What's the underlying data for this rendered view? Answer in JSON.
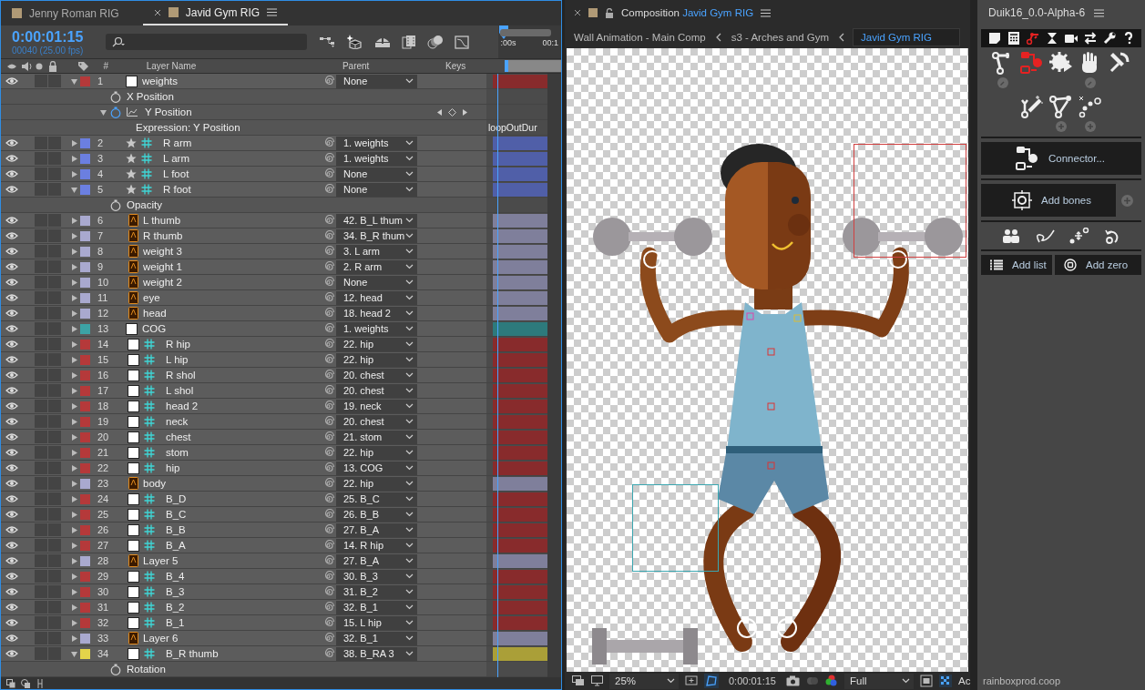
{
  "timeline": {
    "tabs": [
      {
        "label": "Jenny Roman RIG",
        "selected": false
      },
      {
        "label": "Javid Gym RIG",
        "selected": true
      }
    ],
    "time": "0:00:01:15",
    "frame_info": "00040 (25.00 fps)",
    "columns": {
      "number": "#",
      "name": "Layer Name",
      "parent": "Parent",
      "keys": "Keys"
    },
    "ruler": [
      ":00s",
      "00:1"
    ],
    "layers": [
      {
        "number": "1",
        "name": "weights",
        "color": "#b5393a",
        "kind": "solid",
        "expanded": true,
        "parent": "None",
        "children": [
          {
            "name": "X Position",
            "kind": "property"
          },
          {
            "name": "Y Position",
            "kind": "graph",
            "expanded": true,
            "children": [
              {
                "name": "Expression: Y Position",
                "kind": "expression",
                "expression": "loopOutDur"
              }
            ]
          }
        ]
      },
      {
        "number": "2",
        "name": "R arm",
        "color": "#6b7fe0",
        "kind": "star-grid",
        "expanded": false,
        "parent": "1. weights"
      },
      {
        "number": "3",
        "name": "L arm",
        "color": "#6b7fe0",
        "kind": "star-grid",
        "expanded": false,
        "parent": "1. weights"
      },
      {
        "number": "4",
        "name": "L foot",
        "color": "#6b7fe0",
        "kind": "star-grid",
        "expanded": false,
        "parent": "None"
      },
      {
        "number": "5",
        "name": "R foot",
        "color": "#6b7fe0",
        "kind": "star-grid",
        "expanded": true,
        "parent": "None",
        "children": [
          {
            "name": "Opacity",
            "kind": "property"
          }
        ]
      },
      {
        "number": "6",
        "name": "L thumb",
        "color": "#a9a9cf",
        "kind": "ai",
        "expanded": false,
        "parent": "42. B_L thum"
      },
      {
        "number": "7",
        "name": "R thumb",
        "color": "#a9a9cf",
        "kind": "ai",
        "expanded": false,
        "parent": "34. B_R thum"
      },
      {
        "number": "8",
        "name": "weight 3",
        "color": "#a9a9cf",
        "kind": "ai",
        "expanded": false,
        "parent": "3. L arm"
      },
      {
        "number": "9",
        "name": "weight 1",
        "color": "#a9a9cf",
        "kind": "ai",
        "expanded": false,
        "parent": "2. R arm"
      },
      {
        "number": "10",
        "name": "weight 2",
        "color": "#a9a9cf",
        "kind": "ai",
        "expanded": false,
        "parent": "None"
      },
      {
        "number": "11",
        "name": "eye",
        "color": "#a9a9cf",
        "kind": "ai",
        "expanded": false,
        "parent": "12. head"
      },
      {
        "number": "12",
        "name": "head",
        "color": "#a9a9cf",
        "kind": "ai",
        "expanded": false,
        "parent": "18. head 2"
      },
      {
        "number": "13",
        "name": "COG",
        "color": "#3ca3a5",
        "kind": "solid",
        "expanded": false,
        "parent": "1. weights"
      },
      {
        "number": "14",
        "name": "R hip",
        "color": "#b5393a",
        "kind": "solid-grid",
        "expanded": false,
        "parent": "22. hip"
      },
      {
        "number": "15",
        "name": "L hip",
        "color": "#b5393a",
        "kind": "solid-grid",
        "expanded": false,
        "parent": "22. hip"
      },
      {
        "number": "16",
        "name": "R shol",
        "color": "#b5393a",
        "kind": "solid-grid",
        "expanded": false,
        "parent": "20. chest"
      },
      {
        "number": "17",
        "name": "L shol",
        "color": "#b5393a",
        "kind": "solid-grid",
        "expanded": false,
        "parent": "20. chest"
      },
      {
        "number": "18",
        "name": "head 2",
        "color": "#b5393a",
        "kind": "solid-grid",
        "expanded": false,
        "parent": "19. neck"
      },
      {
        "number": "19",
        "name": "neck",
        "color": "#b5393a",
        "kind": "solid-grid",
        "expanded": false,
        "parent": "20. chest"
      },
      {
        "number": "20",
        "name": "chest",
        "color": "#b5393a",
        "kind": "solid-grid",
        "expanded": false,
        "parent": "21. stom"
      },
      {
        "number": "21",
        "name": "stom",
        "color": "#b5393a",
        "kind": "solid-grid",
        "expanded": false,
        "parent": "22. hip"
      },
      {
        "number": "22",
        "name": "hip",
        "color": "#b5393a",
        "kind": "solid-grid",
        "expanded": false,
        "parent": "13. COG"
      },
      {
        "number": "23",
        "name": "body",
        "color": "#a9a9cf",
        "kind": "ai",
        "expanded": false,
        "parent": "22. hip"
      },
      {
        "number": "24",
        "name": "B_D",
        "color": "#b5393a",
        "kind": "solid-grid",
        "expanded": false,
        "parent": "25. B_C"
      },
      {
        "number": "25",
        "name": "B_C",
        "color": "#b5393a",
        "kind": "solid-grid",
        "expanded": false,
        "parent": "26. B_B"
      },
      {
        "number": "26",
        "name": "B_B",
        "color": "#b5393a",
        "kind": "solid-grid",
        "expanded": false,
        "parent": "27. B_A"
      },
      {
        "number": "27",
        "name": "B_A",
        "color": "#b5393a",
        "kind": "solid-grid",
        "expanded": false,
        "parent": "14. R hip"
      },
      {
        "number": "28",
        "name": "Layer 5",
        "color": "#a9a9cf",
        "kind": "ai",
        "expanded": false,
        "parent": "27. B_A"
      },
      {
        "number": "29",
        "name": "B_4",
        "color": "#b5393a",
        "kind": "solid-grid",
        "expanded": false,
        "parent": "30. B_3"
      },
      {
        "number": "30",
        "name": "B_3",
        "color": "#b5393a",
        "kind": "solid-grid",
        "expanded": false,
        "parent": "31. B_2"
      },
      {
        "number": "31",
        "name": "B_2",
        "color": "#b5393a",
        "kind": "solid-grid",
        "expanded": false,
        "parent": "32. B_1"
      },
      {
        "number": "32",
        "name": "B_1",
        "color": "#b5393a",
        "kind": "solid-grid",
        "expanded": false,
        "parent": "15. L hip"
      },
      {
        "number": "33",
        "name": "Layer 6",
        "color": "#a9a9cf",
        "kind": "ai",
        "expanded": false,
        "parent": "32. B_1"
      },
      {
        "number": "34",
        "name": "B_R thumb",
        "color": "#e3d44a",
        "kind": "solid-grid",
        "expanded": true,
        "parent": "38. B_RA 3",
        "children": [
          {
            "name": "Rotation",
            "kind": "property"
          }
        ]
      }
    ]
  },
  "composition": {
    "title_prefix": "Composition",
    "title": "Javid Gym RIG",
    "breadcrumbs": [
      {
        "label": "Wall Animation - Main Comp",
        "selected": false
      },
      {
        "label": "s3 - Arches and Gym",
        "selected": false
      },
      {
        "label": "Javid Gym RIG",
        "selected": true
      }
    ],
    "zoom": "25%",
    "time": "0:00:01:15",
    "resolution": "Full",
    "extra": "Ac"
  },
  "duik": {
    "title": "Duik16_0.0-Alpha-6",
    "tabs": [
      {
        "selected": false
      },
      {
        "selected": false
      },
      {
        "selected": true
      },
      {
        "selected": false
      },
      {
        "selected": false
      },
      {
        "selected": false
      },
      {
        "selected": false
      },
      {
        "selected": false
      }
    ],
    "tools": [
      {
        "selected": false
      },
      {
        "selected": true
      },
      {
        "selected": false
      },
      {
        "selected": false
      },
      {
        "selected": false
      },
      {
        "selected": false
      },
      {
        "selected": false
      },
      {
        "selected": false
      }
    ],
    "connector": "Connector...",
    "add_bones": "Add bones",
    "add_list": "Add list",
    "add_zero": "Add zero",
    "footer": "rainboxprod.coop"
  }
}
